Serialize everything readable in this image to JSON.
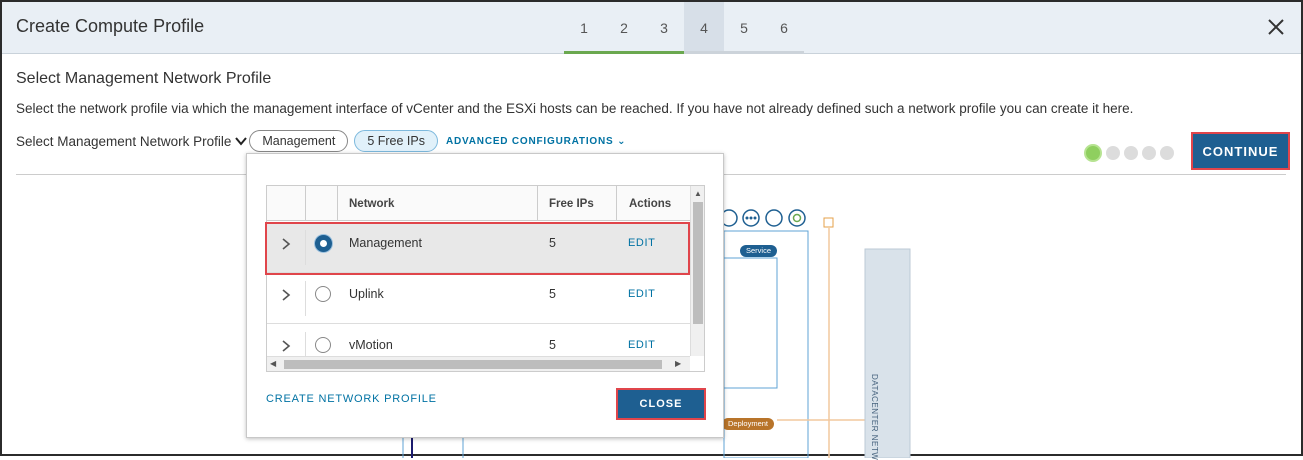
{
  "window": {
    "title": "Create Compute Profile",
    "close_icon": "close-icon",
    "steps": [
      "1",
      "2",
      "3",
      "4",
      "5",
      "6"
    ],
    "active_step": "4"
  },
  "page": {
    "heading": "Select Management Network Profile",
    "description": "Select the network profile via which the management interface of vCenter and the ESXi hosts can be reached. If you have not already defined such a network profile you can create it here.",
    "select_label": "Select Management Network Profile",
    "selected_profile": "Management",
    "free_ips_pill": "5 Free IPs",
    "advanced_label": "ADVANCED CONFIGURATIONS",
    "continue_label": "CONTINUE"
  },
  "diagram": {
    "service_badge": "Service",
    "deployment_badge": "Deployment",
    "datacenter_label": "DATACENTER NETW"
  },
  "popover": {
    "columns": [
      "Network",
      "Free IPs",
      "Actions"
    ],
    "rows": [
      {
        "network": "Management",
        "free_ips": "5",
        "action": "EDIT",
        "selected": true
      },
      {
        "network": "Uplink",
        "free_ips": "5",
        "action": "EDIT",
        "selected": false
      },
      {
        "network": "vMotion",
        "free_ips": "5",
        "action": "EDIT",
        "selected": false
      }
    ],
    "create_link": "CREATE NETWORK PROFILE",
    "close_label": "CLOSE"
  },
  "colors": {
    "primary": "#1e5f91",
    "link": "#0072a3",
    "highlight": "#e0454b",
    "progress_done": "#6aa84f"
  }
}
